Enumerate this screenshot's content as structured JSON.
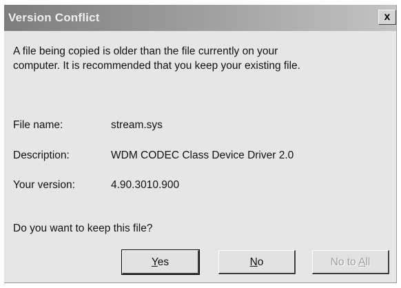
{
  "window": {
    "title": "Version Conflict",
    "close_label": "x"
  },
  "message": {
    "line1": "A file being copied is older than the file currently on your",
    "line2": "computer. It is recommended that you keep your existing file."
  },
  "fields": [
    {
      "label": "File name:",
      "value": "stream.sys"
    },
    {
      "label": "Description:",
      "value": "WDM CODEC Class Device Driver 2.0"
    },
    {
      "label": "Your version:",
      "value": "4.90.3010.900"
    }
  ],
  "question": "Do you want to keep this file?",
  "buttons": {
    "yes": {
      "accel": "Y",
      "rest": "es"
    },
    "no": {
      "accel": "N",
      "rest": "o"
    },
    "no_to_all": {
      "prefix": "No to ",
      "accel": "A",
      "rest": "ll",
      "disabled": true
    }
  }
}
